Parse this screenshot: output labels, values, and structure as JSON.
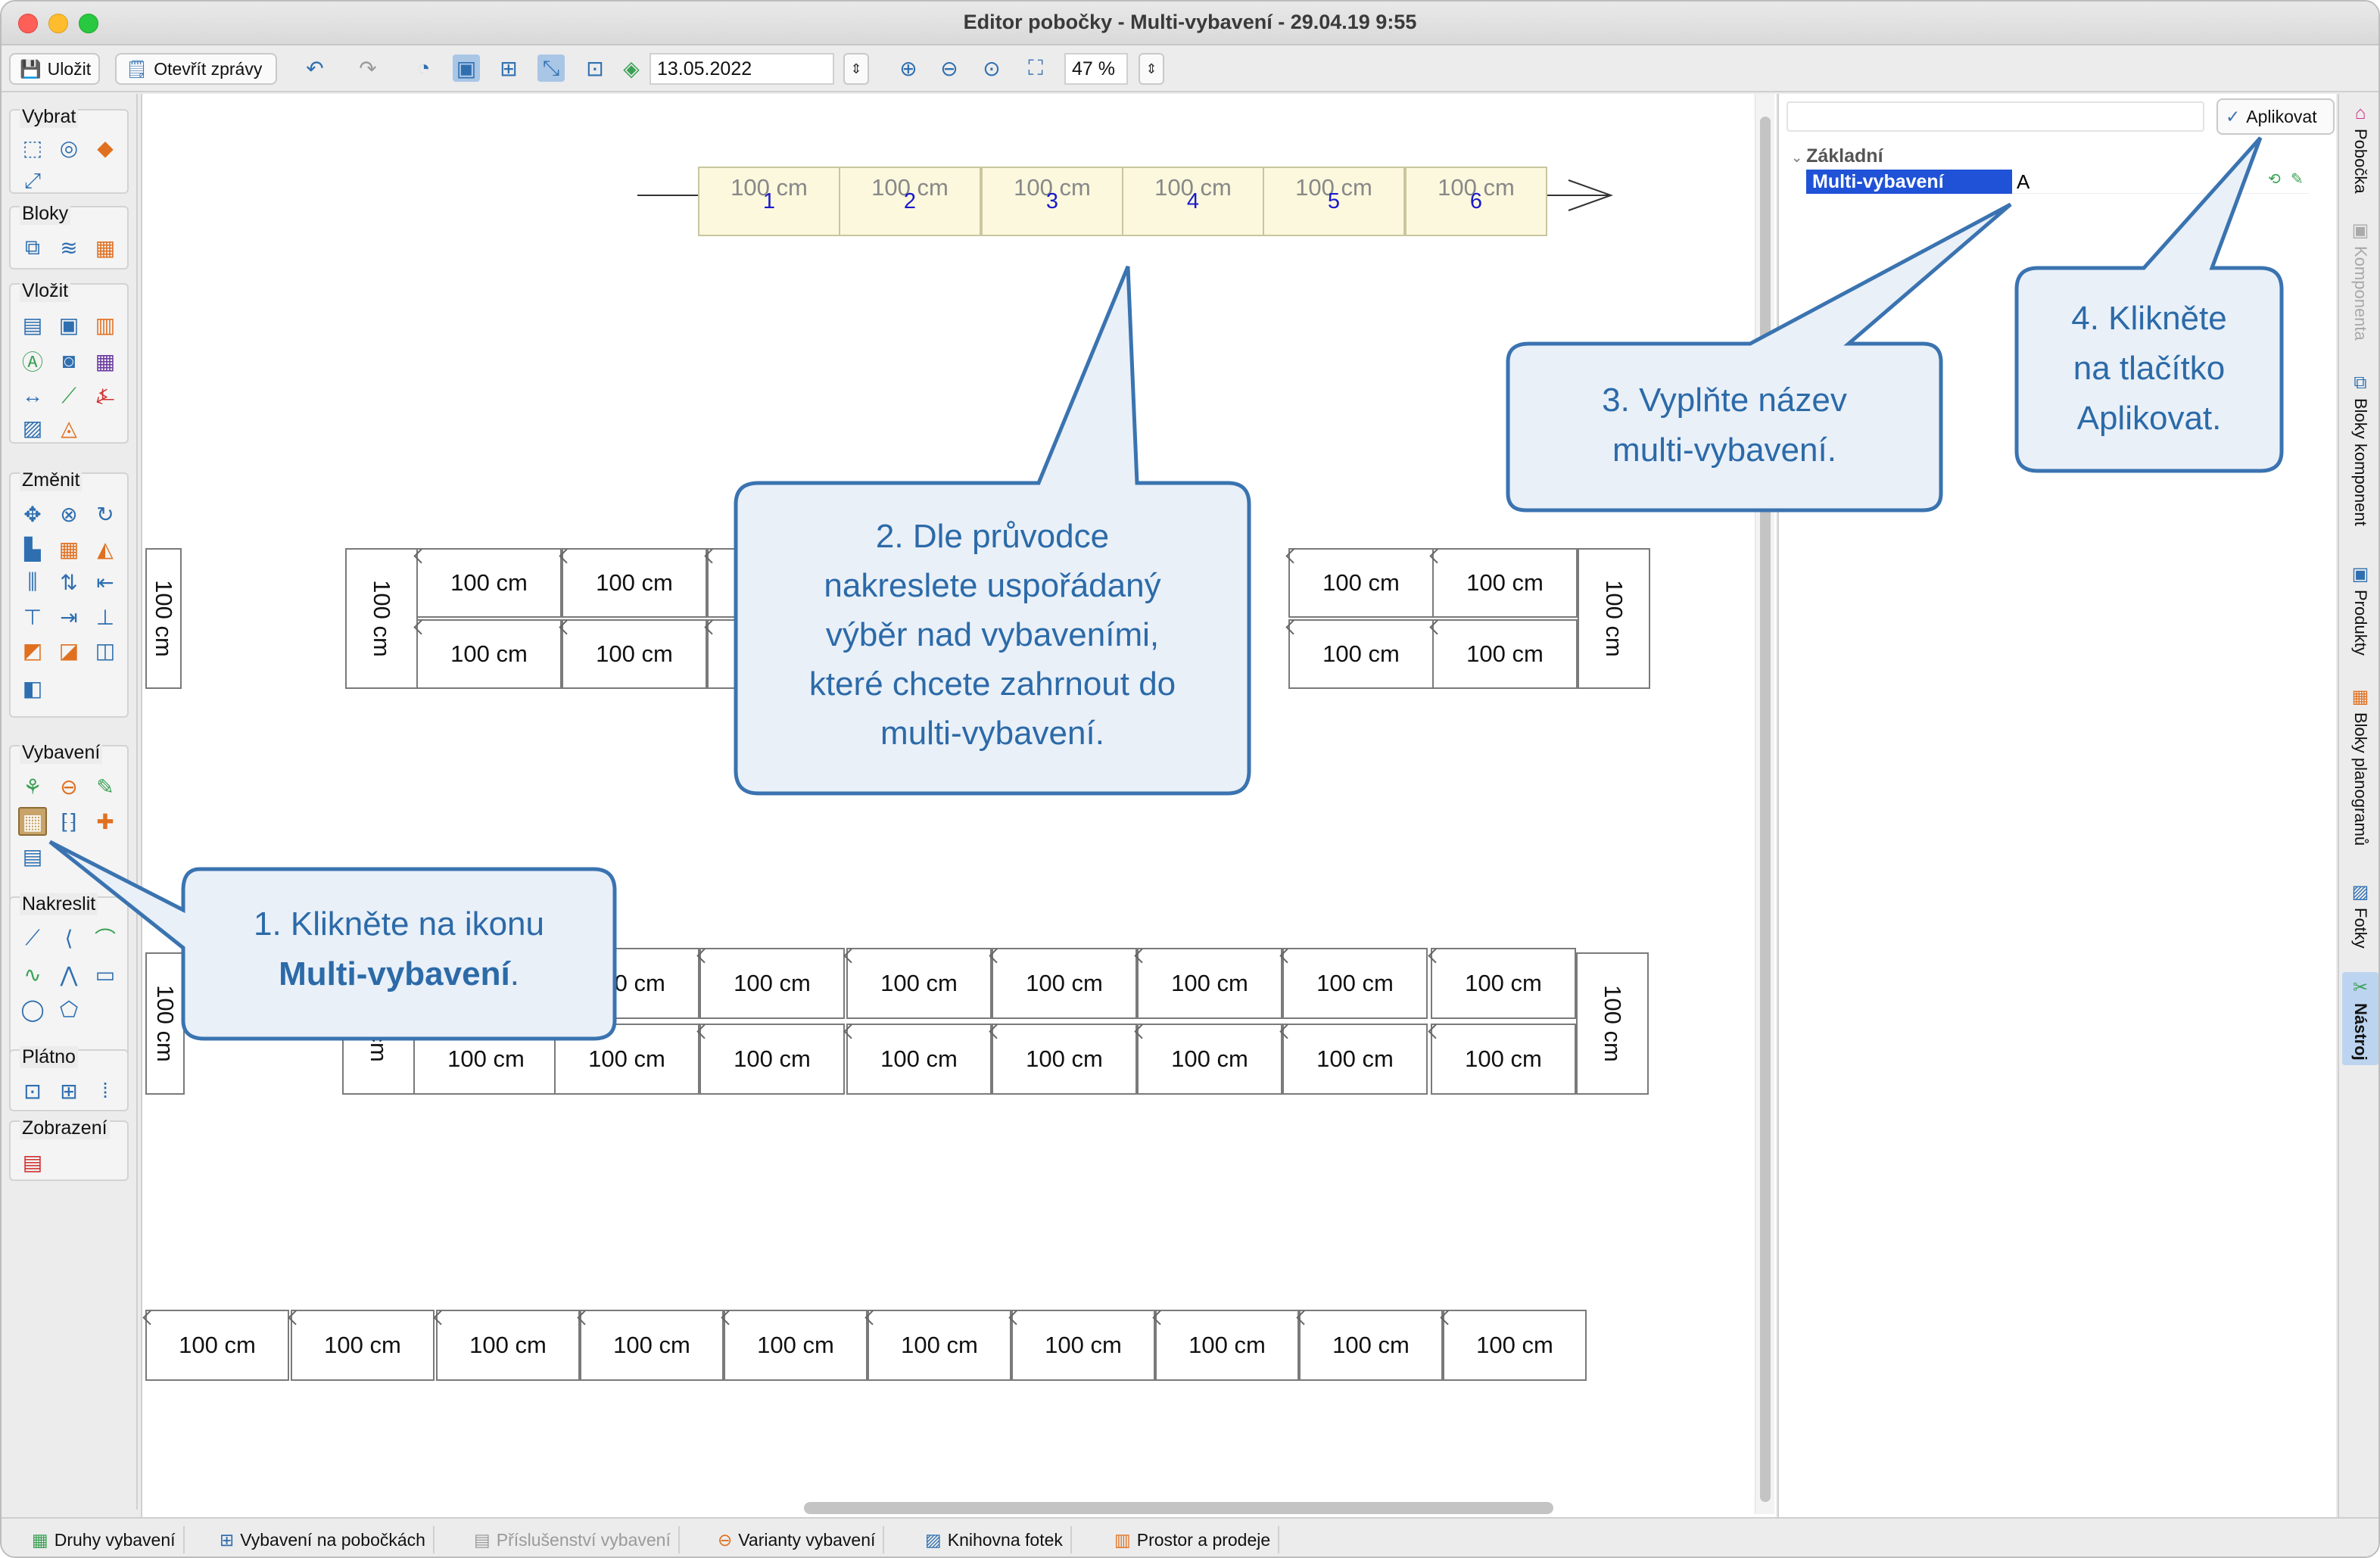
{
  "window": {
    "title": "Editor pobočky - Multi-vybavení - 29.04.19 9:55"
  },
  "toolbar": {
    "save_label": "Uložit",
    "open_reports_label": "Otevřít zprávy",
    "date_value": "13.05.2022",
    "zoom_value": "47 %"
  },
  "palette": {
    "groups": [
      "Vybrat",
      "Bloky",
      "Vložit",
      "Změnit",
      "Vybavení",
      "Nakreslit",
      "Plátno",
      "Zobrazení"
    ]
  },
  "canvas": {
    "cell_label": "100 cm",
    "sequence": [
      "1",
      "2",
      "3",
      "4",
      "5",
      "6"
    ]
  },
  "callouts": {
    "one_prefix": "1. Klikněte na ikonu",
    "one_bold": "Multi-vybavení",
    "one_suffix": ".",
    "two": [
      "2. Dle průvodce",
      "nakreslete uspořádaný",
      "výběr nad vybaveními,",
      "které chcete zahrnout do",
      "multi-vybavení."
    ],
    "three": [
      "3. Vyplňte název",
      "multi-vybavení."
    ],
    "four": [
      "4. Klikněte",
      "na tlačítko",
      "Aplikovat."
    ]
  },
  "properties": {
    "search_placeholder": "",
    "apply_label": "Aplikovat",
    "section": "Základní",
    "name_label": "Multi-vybavení",
    "name_value": "A"
  },
  "side_tabs": [
    {
      "label": "Pobočka",
      "enabled": true
    },
    {
      "label": "Komponenta",
      "enabled": false
    },
    {
      "label": "Bloky komponent",
      "enabled": true
    },
    {
      "label": "Produkty",
      "enabled": true
    },
    {
      "label": "Bloky planogramů",
      "enabled": true
    },
    {
      "label": "Fotky",
      "enabled": true
    },
    {
      "label": "Nástroj",
      "enabled": true,
      "active": true
    }
  ],
  "bottom_tabs": [
    {
      "label": "Druhy vybavení",
      "enabled": true
    },
    {
      "label": "Vybavení na pobočkách",
      "enabled": true
    },
    {
      "label": "Příslušenství vybavení",
      "enabled": false
    },
    {
      "label": "Varianty vybavení",
      "enabled": true
    },
    {
      "label": "Knihovna fotek",
      "enabled": true
    },
    {
      "label": "Prostor a prodeje",
      "enabled": true
    }
  ],
  "colors": {
    "callout_border": "#3a73b0",
    "callout_fill": "#e9f0f8",
    "selection": "#1f52d6"
  }
}
